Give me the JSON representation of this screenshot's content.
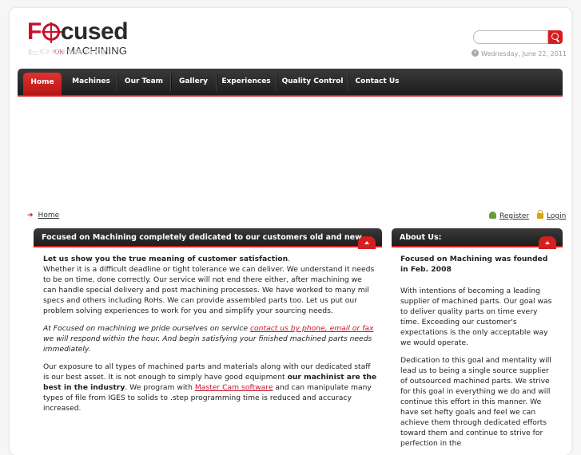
{
  "brand": {
    "part1": "F",
    "part2": "cused",
    "on": "ON",
    "machining": "MACHINING",
    "reflection": "Focused"
  },
  "search": {
    "placeholder": "",
    "value": ""
  },
  "date": "Wednesday, June 22, 2011",
  "nav": {
    "items": [
      {
        "label": "Home",
        "active": true
      },
      {
        "label": "Machines"
      },
      {
        "label": "Our Team"
      },
      {
        "label": "Gallery"
      },
      {
        "label": "Experiences"
      },
      {
        "label": "Quality Control"
      },
      {
        "label": "Contact Us"
      }
    ]
  },
  "breadcrumb": {
    "home": "Home"
  },
  "user": {
    "register": "Register",
    "login": "Login"
  },
  "main": {
    "title": "Focused on Machining completely dedicated to our customers old and new",
    "p1_bold": "Let us show you the true meaning of customer satisfaction",
    "p1_dot": ".",
    "p1_text": "Whether it is a difficult deadline or tight tolerance we can deliver. We understand it needs to be on time, done correctly. Our service will not end there either, after machining we can handle special delivery and post machining processes. We have worked to many mil specs and others including RoHs. We can provide assembled parts too. Let us put our problem solving experiences to work for you and simplify your sourcing needs.",
    "p2_a": "At Focused on machining we pride ourselves on service ",
    "p2_link": "contact us by phone, email or fax ",
    "p2_b": "we will respond within the hour. And begin satisfying your finished machined parts needs immediately.",
    "p3_a": "Our exposure to all types of machined parts and materials along with our dedicated staff is our best asset. It is not enough to simply have good equipment ",
    "p3_bold": "our machinist are the best in the industry",
    "p3_b": ".  We program with ",
    "p3_link": "Master Cam software",
    "p3_c": " and can manipulate many types of file from IGES to solids to .step programming time is reduced and accuracy increased."
  },
  "side": {
    "title": "About Us:",
    "p1": "Focused on Machining was founded in Feb. 2008",
    "p2": "With intentions of becoming a leading supplier of machined parts.  Our goal was to deliver quality parts on time every time. Exceeding our customer's expectations is the only acceptable way we would operate.",
    "p3": "Dedication to this goal and mentality will lead us to being a single source supplier of outsourced machined parts. We strive for this goal in everything we do and will continue this effort in this manner. We have set hefty goals and feel we can achieve them through dedicated efforts toward them and continue to strive for perfection in the"
  },
  "colors": {
    "accent": "#d41f1f",
    "nav_bg": "#2a2a2a"
  }
}
